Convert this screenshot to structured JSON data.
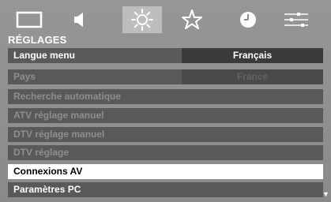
{
  "tabs": [
    {
      "icon": "picture-icon"
    },
    {
      "icon": "sound-speaker-icon"
    },
    {
      "icon": "settings-sun-icon",
      "active": true
    },
    {
      "icon": "features-star-icon"
    },
    {
      "icon": "timer-clock-icon"
    },
    {
      "icon": "setup-sliders-icon"
    }
  ],
  "menu": {
    "title": "RÉGLAGES",
    "items": [
      {
        "label": "Langue menu",
        "value": "Français"
      },
      {
        "label": "Pays",
        "value": "France",
        "disabled": true
      },
      {
        "label": "Recherche automatique",
        "disabled": true
      },
      {
        "label": "ATV réglage manuel",
        "disabled": true
      },
      {
        "label": "DTV réglage manuel",
        "disabled": true
      },
      {
        "label": "DTV réglage",
        "disabled": true
      },
      {
        "label": "Connexions AV",
        "selected": true
      },
      {
        "label": "Paramètres PC"
      }
    ],
    "scroll_indicator": "▼"
  },
  "colors": {
    "background": "#8c8c8c",
    "row": "#595959",
    "value_box": "#3a3a3a",
    "selected_row": "#ffffff",
    "disabled_text": "#8e8e8e"
  }
}
